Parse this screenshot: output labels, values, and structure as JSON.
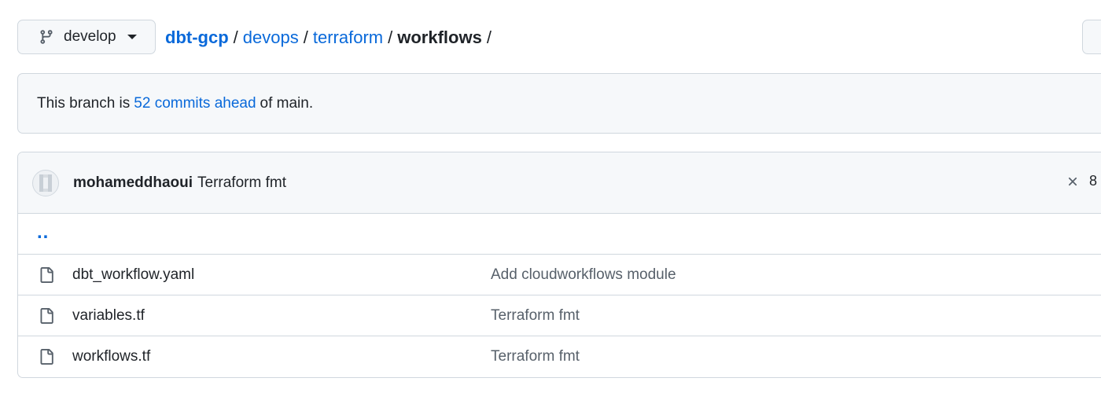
{
  "branch": {
    "icon": "git-branch-icon",
    "name": "develop",
    "caret_icon": "caret-down-icon"
  },
  "breadcrumb": {
    "repo": "dbt-gcp",
    "parts": [
      "devops",
      "terraform"
    ],
    "current": "workflows",
    "separator": "/"
  },
  "ahead_banner": {
    "prefix": "This branch is",
    "link": "52 commits ahead",
    "suffix": "of main."
  },
  "latest_commit": {
    "avatar_icon": "avatar",
    "author": "mohameddhaoui",
    "message": "Terraform fmt",
    "status_icon": "x-icon",
    "status_partial": "8"
  },
  "parent_dir": "..",
  "files": [
    {
      "icon": "file-icon",
      "name": "dbt_workflow.yaml",
      "commit": "Add cloudworkflows module"
    },
    {
      "icon": "file-icon",
      "name": "variables.tf",
      "commit": "Terraform fmt"
    },
    {
      "icon": "file-icon",
      "name": "workflows.tf",
      "commit": "Terraform fmt"
    }
  ],
  "colors": {
    "link": "#0969da",
    "border": "#d0d7de",
    "subtle_bg": "#f6f8fa",
    "text": "#1f2328",
    "muted": "#57606a"
  }
}
